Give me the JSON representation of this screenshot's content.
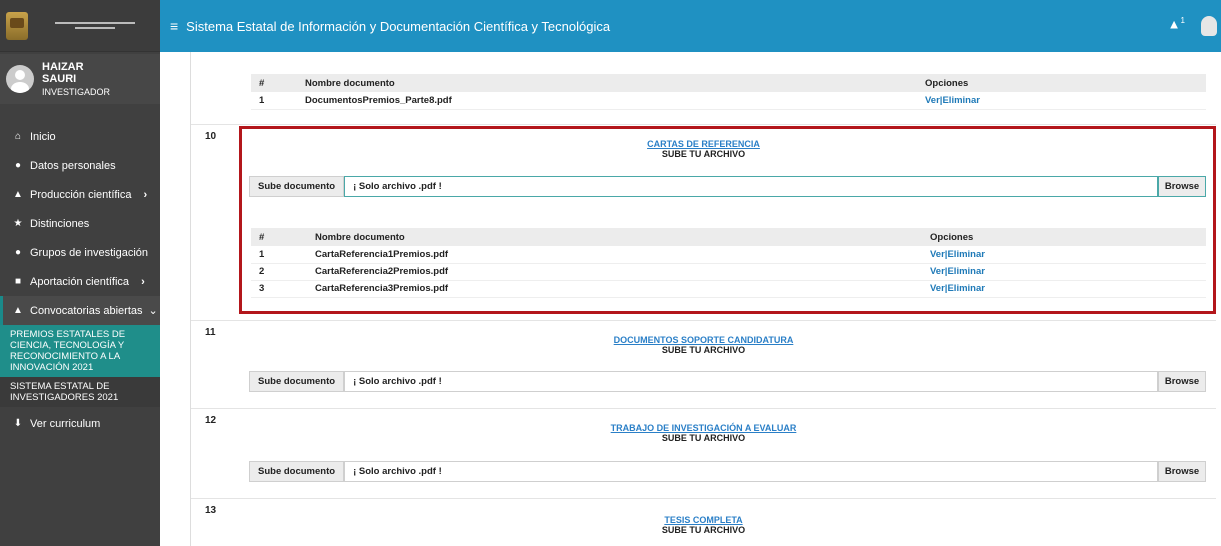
{
  "header": {
    "title": "Sistema Estatal de Información y Documentación Científica y Tecnológica",
    "bell_count": "1"
  },
  "user": {
    "first": "HAIZAR",
    "last": "SAURI",
    "role": "INVESTIGADOR"
  },
  "nav": {
    "inicio": "Inicio",
    "datos": "Datos personales",
    "produccion": "Producción científica",
    "distinciones": "Distinciones",
    "grupos": "Grupos de investigación",
    "aportacion": "Aportación científica",
    "convocatorias": "Convocatorias abiertas",
    "sub1": "PREMIOS ESTATALES DE CIENCIA, TECNOLOGÍA Y RECONOCIMIENTO A LA INNOVACIÓN 2021",
    "sub2": "SISTEMA ESTATAL DE INVESTIGADORES 2021",
    "curriculum": "Ver curriculum"
  },
  "common": {
    "col_num": "#",
    "col_name": "Nombre documento",
    "col_opts": "Opciones",
    "ver": "Ver",
    "sep": "|",
    "eliminar": "Eliminar",
    "sube_label": "Sube documento",
    "placeholder": "¡ Solo archivo .pdf !",
    "browse": "Browse",
    "sube_tu_archivo": "SUBE TU ARCHIVO"
  },
  "top_table": {
    "rows": [
      {
        "n": "1",
        "name": "DocumentosPremios_Parte8.pdf"
      }
    ]
  },
  "sections": [
    {
      "num": "10",
      "title": "CARTAS DE REFERENCIA",
      "files": [
        {
          "n": "1",
          "name": "CartaReferencia1Premios.pdf"
        },
        {
          "n": "2",
          "name": "CartaReferencia2Premios.pdf"
        },
        {
          "n": "3",
          "name": "CartaReferencia3Premios.pdf"
        }
      ]
    },
    {
      "num": "11",
      "title": "DOCUMENTOS SOPORTE CANDIDATURA"
    },
    {
      "num": "12",
      "title": "TRABAJO DE INVESTIGACIÓN A EVALUAR"
    },
    {
      "num": "13",
      "title": "TESIS COMPLETA"
    }
  ],
  "colors": {
    "header": "#1f91c2",
    "sidebar": "#404040",
    "highlight": "#b3161b",
    "active_sub": "#1f8e8a"
  }
}
